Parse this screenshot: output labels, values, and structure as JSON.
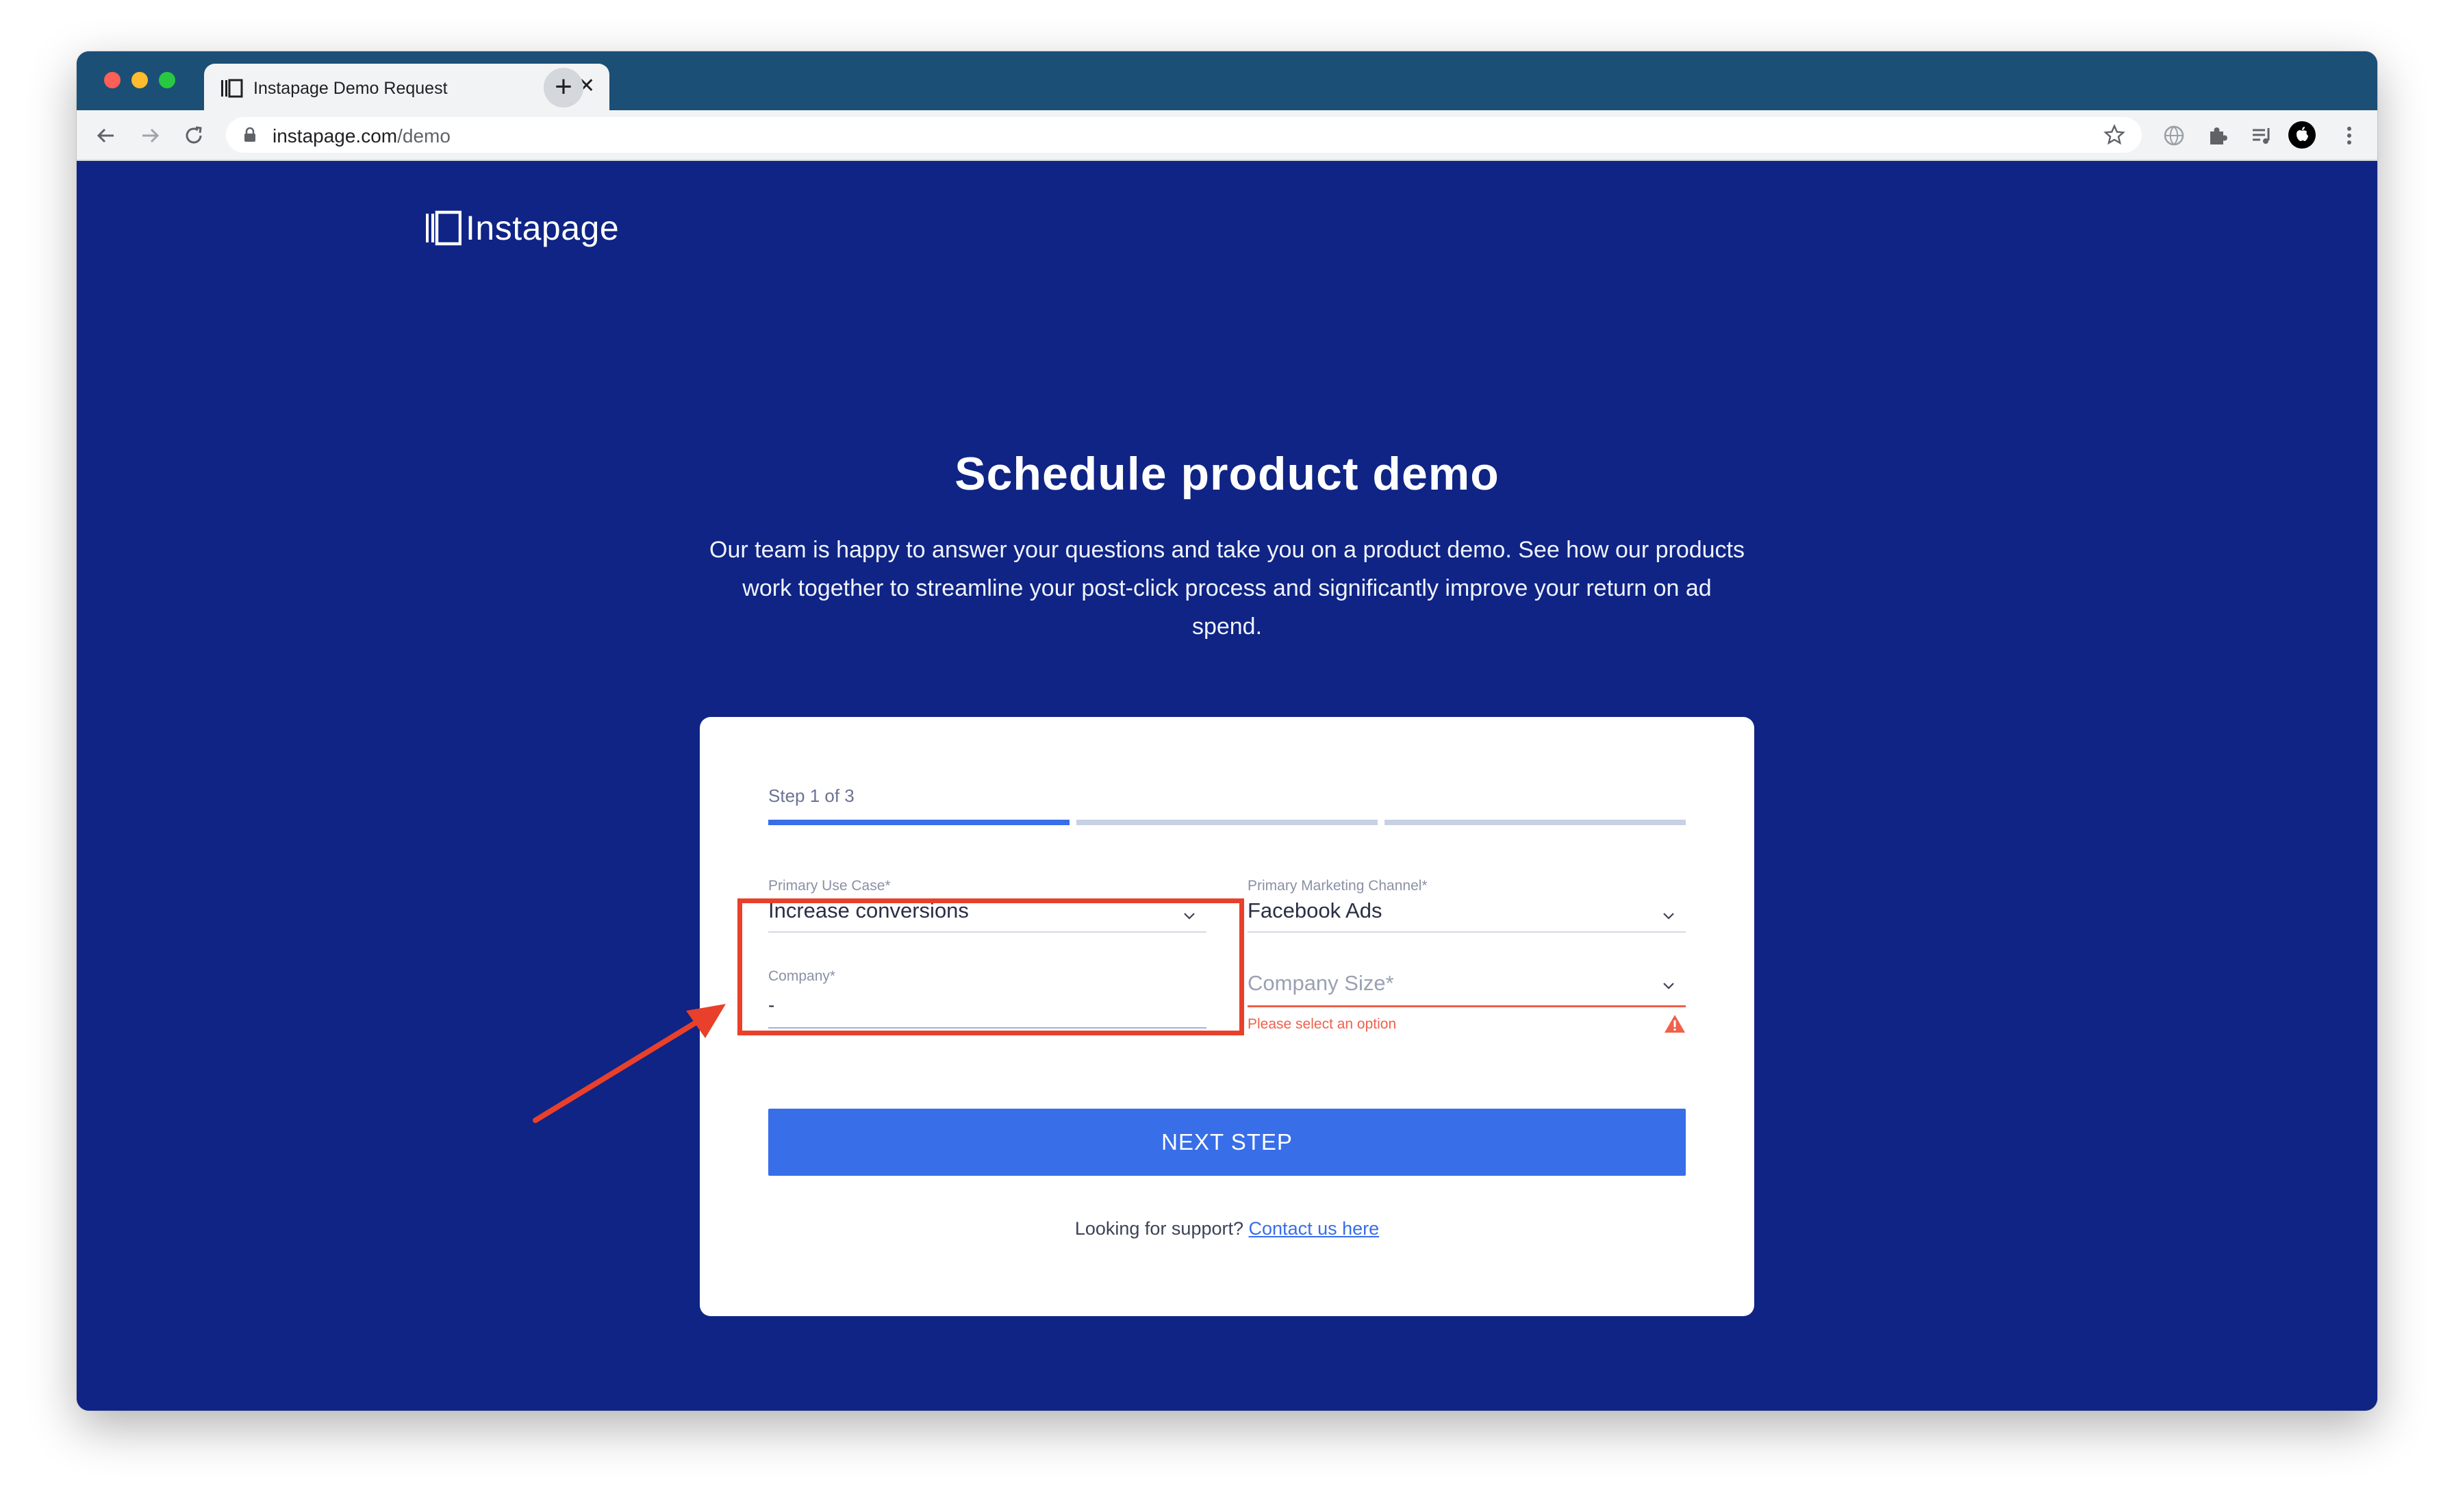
{
  "browser": {
    "tab_title": "Instapage Demo Request",
    "tab_close": "✕",
    "new_tab": "+",
    "url_domain": "instapage.com",
    "url_path": "/demo"
  },
  "page": {
    "logo_text": "Instapage",
    "heading": "Schedule product demo",
    "subtext": "Our team is happy to answer your questions and take you on a product demo. See how our products work together to streamline your post-click process and significantly improve your return on ad spend."
  },
  "form": {
    "step_label": "Step 1 of 3",
    "progress": {
      "current_step": 1,
      "total_steps": 3
    },
    "primary_use_case": {
      "label": "Primary Use Case*",
      "value": "Increase conversions"
    },
    "primary_marketing_channel": {
      "label": "Primary Marketing Channel*",
      "value": "Facebook Ads"
    },
    "company": {
      "label": "Company*",
      "value": "-"
    },
    "company_size": {
      "placeholder": "Company Size*",
      "error": "Please select an option"
    },
    "next_button": "NEXT STEP",
    "support_text": "Looking for support?",
    "support_link": "Contact us here"
  },
  "colors": {
    "page_background": "#0f2484",
    "primary_button": "#386ee8",
    "error": "#f0604b",
    "annotation": "#e8402a"
  },
  "icons": {
    "back": "arrow-left-icon",
    "forward": "arrow-right-icon",
    "reload": "reload-icon",
    "lock": "lock-icon",
    "bookmark": "star-icon",
    "extensions": [
      "globe-icon",
      "puzzle-icon",
      "playlist-icon"
    ],
    "menu": "kebab-menu-icon",
    "features": [
      "team-icon",
      "document-icon",
      "browser-icon"
    ]
  }
}
